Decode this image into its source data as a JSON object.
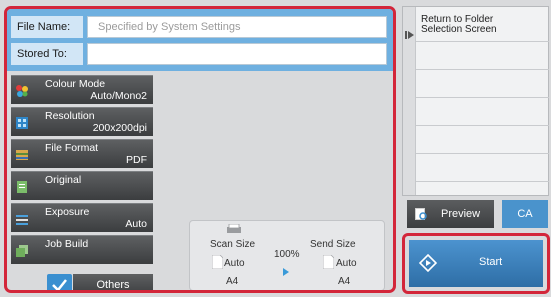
{
  "fields": {
    "file_name_label": "File Name:",
    "file_name_placeholder": "Specified by System Settings",
    "stored_to_label": "Stored To:"
  },
  "modes": [
    {
      "label": "Colour Mode",
      "value": "Auto/Mono2",
      "icon": "colour-icon"
    },
    {
      "label": "Resolution",
      "value": "200x200dpi",
      "icon": "resolution-icon"
    },
    {
      "label": "File Format",
      "value": "PDF",
      "icon": "file-format-icon"
    },
    {
      "label": "Original",
      "value": "",
      "icon": "original-icon"
    },
    {
      "label": "Exposure",
      "value": "Auto",
      "icon": "exposure-icon"
    },
    {
      "label": "Job Build",
      "value": "",
      "icon": "job-build-icon"
    }
  ],
  "others_label": "Others",
  "scan_summary": {
    "scan_size_label": "Scan Size",
    "scan_size_value": "Auto",
    "scan_size_paper": "A4",
    "ratio": "100%",
    "send_size_label": "Send Size",
    "send_size_value": "Auto",
    "send_size_paper": "A4"
  },
  "folder_panel": {
    "return_label_line1": "Return to Folder",
    "return_label_line2": "Selection Screen"
  },
  "actions": {
    "preview_label": "Preview",
    "ca_label": "CA",
    "start_label": "Start"
  },
  "colors": {
    "accent_blue": "#3a8fd0",
    "highlight_red": "#d3263a",
    "field_bar": "#6fb0e0"
  }
}
